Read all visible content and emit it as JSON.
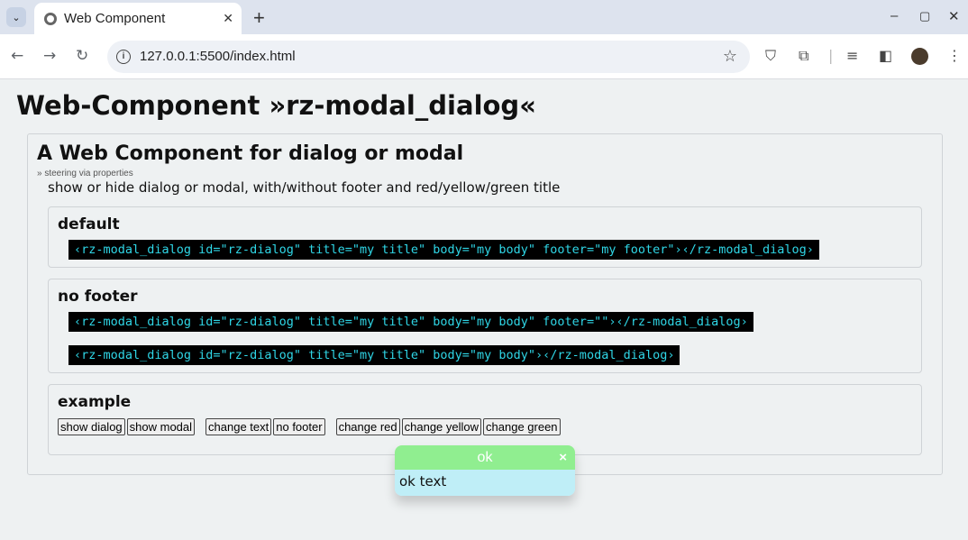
{
  "browser": {
    "tab_title": "Web Component",
    "tab_close": "✕",
    "new_tab": "+",
    "url": "127.0.0.1:5500/index.html",
    "icons": [
      "tab-list-icon",
      "globe-icon",
      "back-icon",
      "forward-icon",
      "reload-icon",
      "info-icon",
      "star-icon",
      "shield-icon",
      "extensions-icon",
      "media-icon",
      "sidepanel-icon",
      "profile-icon",
      "menu-icon"
    ],
    "window": {
      "minimize": "–",
      "maximize": "▢",
      "close": "✕"
    }
  },
  "page": {
    "title": "Web-Component »rz-modal_dialog«",
    "card_title": "A Web Component for dialog or modal",
    "subnote": "» steering via properties",
    "intro": "show or hide dialog or modal, with/without footer and red/yellow/green title"
  },
  "sections": {
    "default": {
      "heading": "default",
      "code": "‹rz-modal_dialog id=\"rz-dialog\" title=\"my title\" body=\"my body\" footer=\"my footer\"›‹/rz-modal_dialog›"
    },
    "no_footer": {
      "heading": "no footer",
      "code1": "‹rz-modal_dialog id=\"rz-dialog\" title=\"my title\" body=\"my body\" footer=\"\"›‹/rz-modal_dialog›",
      "code2": "‹rz-modal_dialog id=\"rz-dialog\" title=\"my title\" body=\"my body\"›‹/rz-modal_dialog›"
    },
    "example": {
      "heading": "example",
      "buttons": [
        "show dialog",
        "show modal",
        "change text",
        "no footer",
        "change red",
        "change yellow",
        "change green"
      ]
    }
  },
  "dialog": {
    "title": "ok",
    "close": "×",
    "body": "ok text",
    "title_color": "#90ee90",
    "body_color": "#bfeef7"
  }
}
